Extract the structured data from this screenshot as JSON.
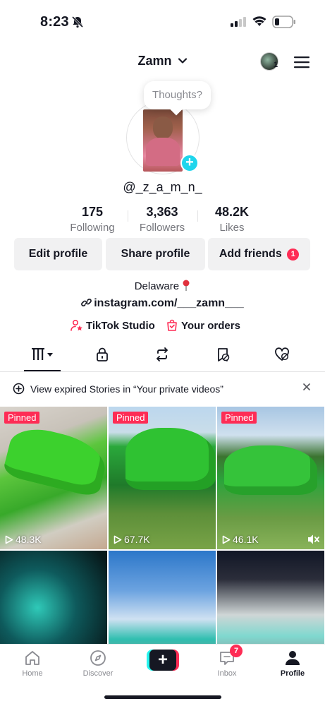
{
  "status_bar": {
    "time": "8:23"
  },
  "header": {
    "title": "Zamn",
    "avatar_badge": "1"
  },
  "profile": {
    "thought_prompt": "Thoughts?",
    "handle": "@_z_a_m_n_",
    "stats": [
      {
        "value": "175",
        "label": "Following"
      },
      {
        "value": "3,363",
        "label": "Followers"
      },
      {
        "value": "48.2K",
        "label": "Likes"
      }
    ],
    "buttons": {
      "edit": "Edit profile",
      "share": "Share profile",
      "add_friends": "Add friends",
      "add_friends_badge": "1"
    },
    "bio": "Delaware",
    "link": "instagram.com/___zamn___",
    "tools": {
      "studio": "TikTok Studio",
      "orders": "Your orders"
    }
  },
  "banner": {
    "text": "View expired Stories in “Your private videos”"
  },
  "videos": [
    {
      "pinned": "Pinned",
      "views": "48.3K"
    },
    {
      "pinned": "Pinned",
      "views": "67.7K"
    },
    {
      "pinned": "Pinned",
      "views": "46.1K"
    },
    {
      "pinned": "",
      "views": ""
    },
    {
      "pinned": "",
      "views": ""
    },
    {
      "pinned": "",
      "views": ""
    }
  ],
  "bottom_nav": {
    "home": "Home",
    "discover": "Discover",
    "create": "+",
    "inbox": "Inbox",
    "inbox_badge": "7",
    "profile": "Profile"
  },
  "colors": {
    "accent": "#fe2c55",
    "story_add": "#20d5ec",
    "text": "#161823",
    "muted": "#75767c"
  }
}
